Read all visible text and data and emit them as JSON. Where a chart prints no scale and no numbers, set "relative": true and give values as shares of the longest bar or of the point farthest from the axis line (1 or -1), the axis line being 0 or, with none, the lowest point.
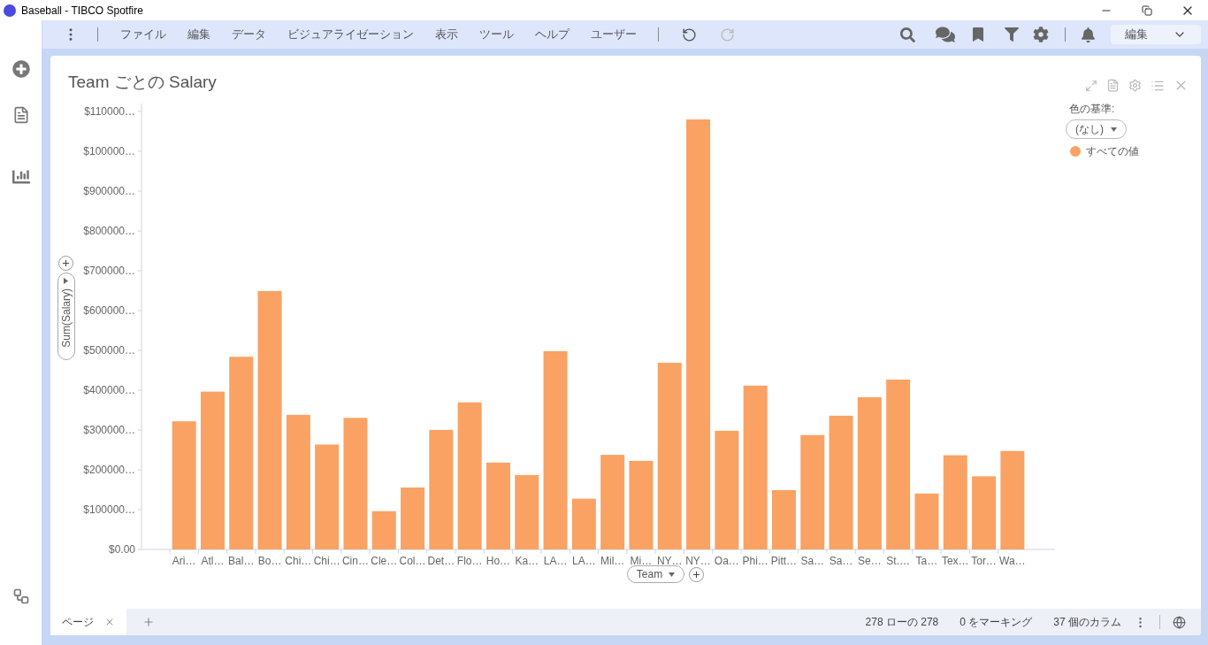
{
  "window": {
    "title": "Baseball - TIBCO Spotfire"
  },
  "menu_bar": {
    "items": [
      "ファイル",
      "編集",
      "データ",
      "ビジュアライゼーション",
      "表示",
      "ツール",
      "ヘルプ",
      "ユーザー"
    ]
  },
  "mode_select": {
    "value": "編集"
  },
  "visualization": {
    "title": "Team ごとの Salary",
    "y_axis_selector": "Sum(Salary)",
    "x_axis_selector": "Team",
    "legend": {
      "title": "色の基準:",
      "dropdown": "(なし)",
      "items": [
        {
          "label": "すべての値",
          "color": "#f9a263"
        }
      ]
    },
    "chart_data": {
      "type": "bar",
      "categories": [
        "Ari…",
        "Atl…",
        "Bal…",
        "Bo…",
        "Chi…",
        "Chi…",
        "Cin…",
        "Cle…",
        "Col…",
        "Det…",
        "Flo…",
        "Ho…",
        "Ka…",
        "LA…",
        "LA…",
        "Mil…",
        "Mi…",
        "NY…",
        "NY…",
        "Oa…",
        "Phi…",
        "Pitt…",
        "Sa…",
        "Sa…",
        "Se…",
        "St.…",
        "Ta…",
        "Tex…",
        "Tor…",
        "Wa…"
      ],
      "values": [
        0.298,
        0.367,
        0.448,
        0.601,
        0.313,
        0.244,
        0.306,
        0.089,
        0.144,
        0.278,
        0.342,
        0.202,
        0.173,
        0.461,
        0.118,
        0.22,
        0.206,
        0.434,
        1,
        0.276,
        0.381,
        0.138,
        0.266,
        0.311,
        0.354,
        0.395,
        0.13,
        0.219,
        0.17,
        0.229
      ],
      "relative": true
    },
    "y_axis_labels": [
      "$110000…",
      "$100000…",
      "$900000…",
      "$800000…",
      "$700000…",
      "$600000…",
      "$500000…",
      "$400000…",
      "$300000…",
      "$200000…",
      "$100000…",
      "$0.00"
    ]
  },
  "page_tabs": [
    {
      "label": "ページ",
      "selected": true
    }
  ],
  "status_bar": {
    "rows": "278 ローの 278",
    "marked": "0 をマーキング",
    "columns": "37 個のカラム"
  }
}
